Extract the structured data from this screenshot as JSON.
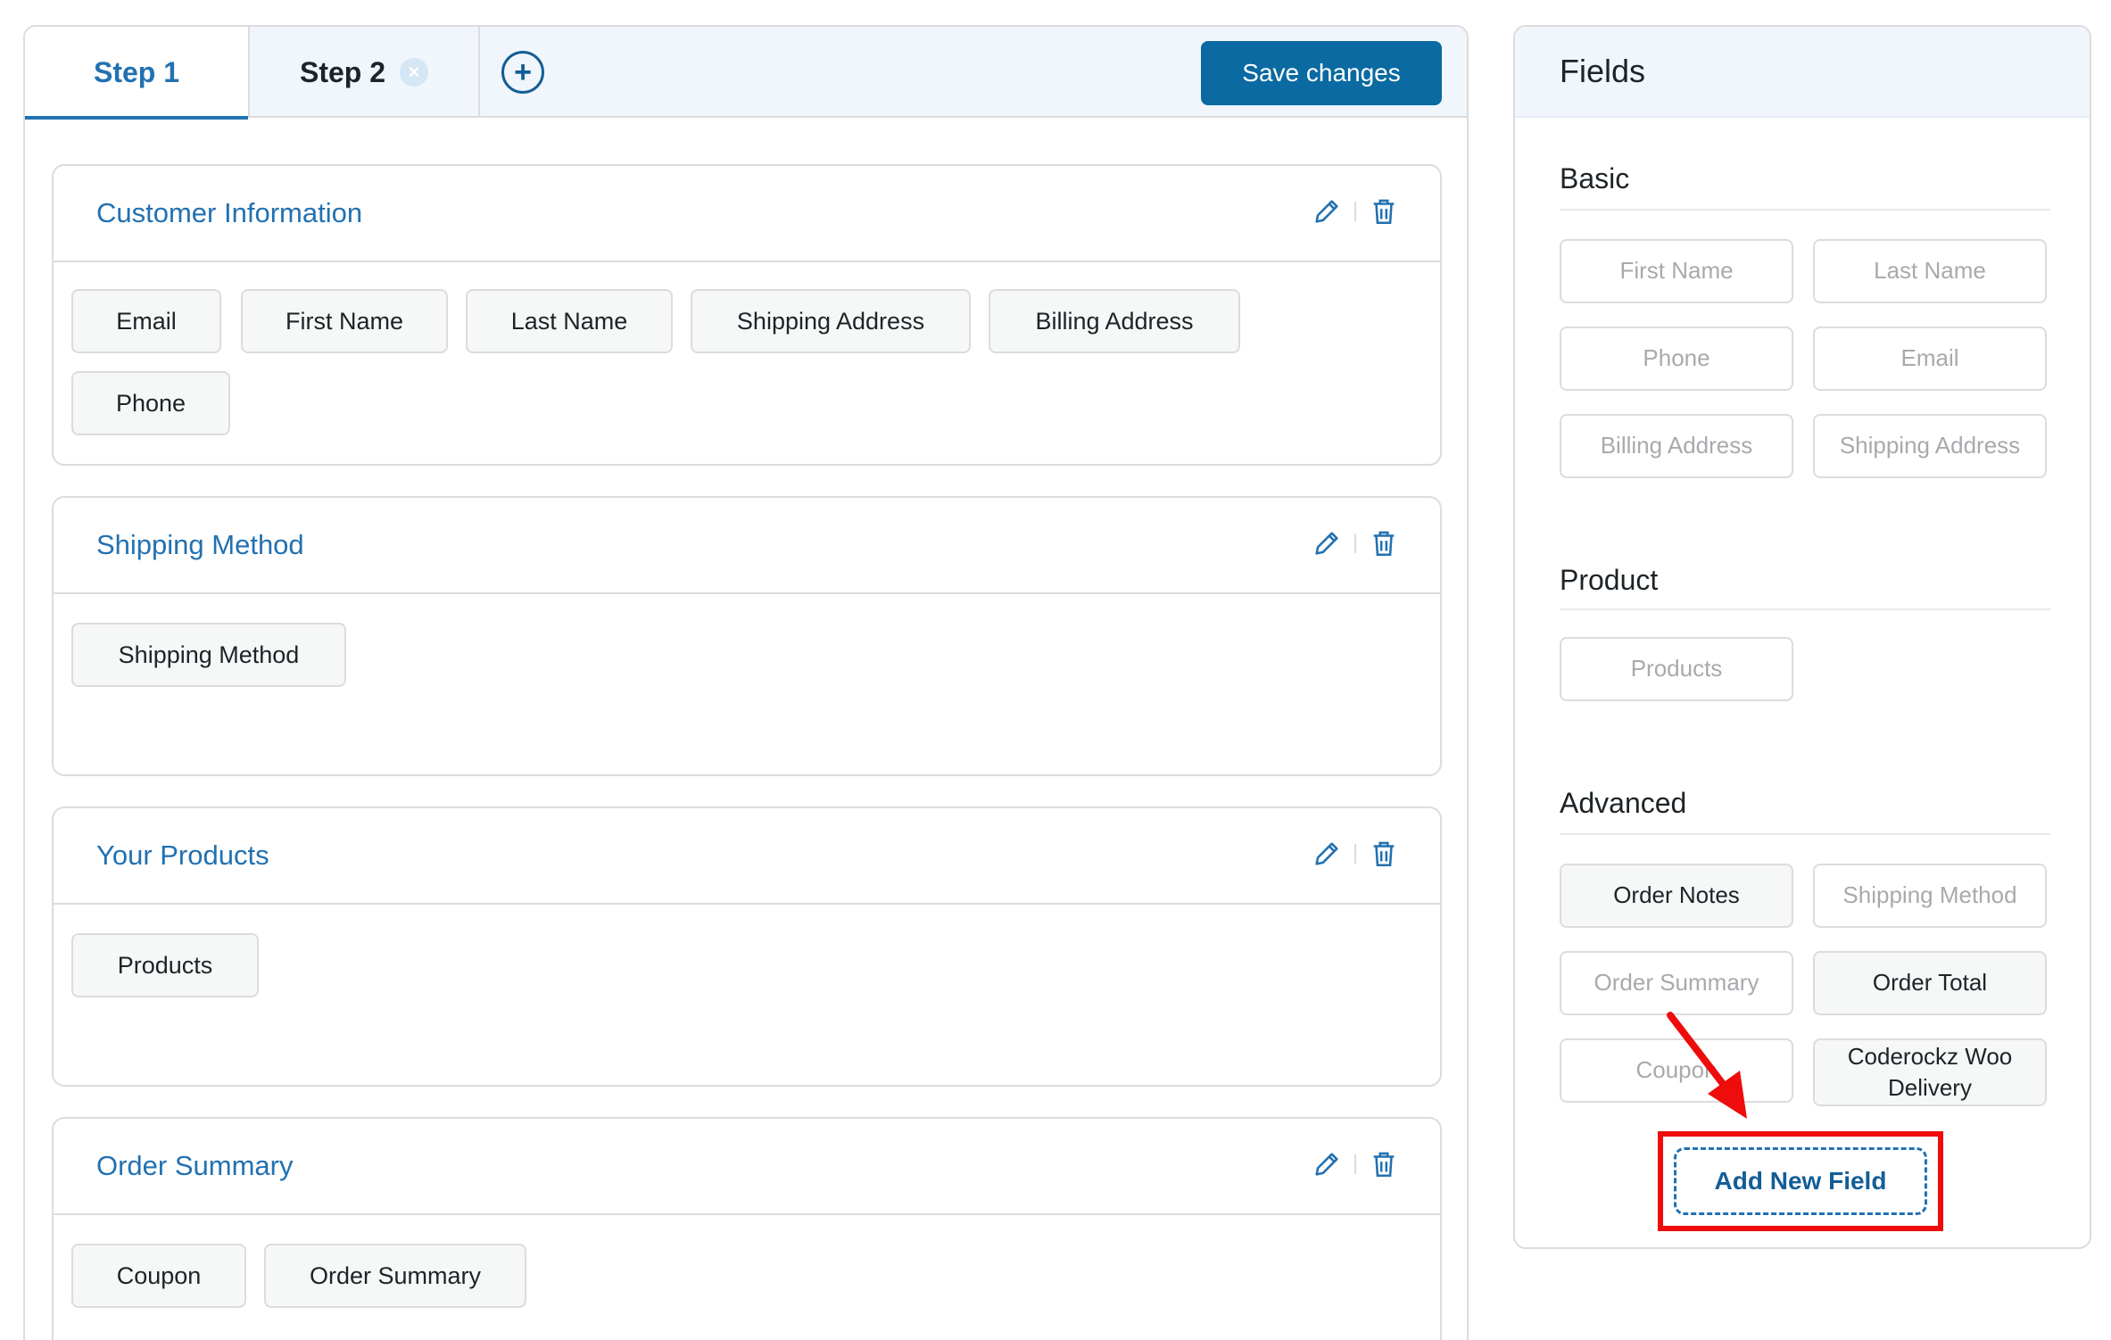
{
  "tabs": {
    "step1": "Step 1",
    "step2": "Step 2",
    "close_glyph": "×",
    "add_glyph": "+"
  },
  "toolbar": {
    "save_label": "Save changes"
  },
  "sections": [
    {
      "title": "Customer Information",
      "fields": [
        "Email",
        "First Name",
        "Last Name",
        "Shipping Address",
        "Billing Address",
        "Phone"
      ]
    },
    {
      "title": "Shipping Method",
      "fields": [
        "Shipping Method"
      ]
    },
    {
      "title": "Your Products",
      "fields": [
        "Products"
      ]
    },
    {
      "title": "Order Summary",
      "fields": [
        "Coupon",
        "Order Summary"
      ]
    }
  ],
  "fields_panel": {
    "title": "Fields",
    "groups": [
      {
        "title": "Basic",
        "items": [
          {
            "label": "First Name",
            "active": false
          },
          {
            "label": "Last Name",
            "active": false
          },
          {
            "label": "Phone",
            "active": false
          },
          {
            "label": "Email",
            "active": false
          },
          {
            "label": "Billing Address",
            "active": false
          },
          {
            "label": "Shipping Address",
            "active": false
          }
        ]
      },
      {
        "title": "Product",
        "items": [
          {
            "label": "Products",
            "active": false
          }
        ]
      },
      {
        "title": "Advanced",
        "items": [
          {
            "label": "Order Notes",
            "active": true
          },
          {
            "label": "Shipping Method",
            "active": false
          },
          {
            "label": "Order Summary",
            "active": false
          },
          {
            "label": "Order Total",
            "active": true
          },
          {
            "label": "Coupon",
            "active": false
          },
          {
            "label": "Coderockz Woo Delivery",
            "active": true
          }
        ]
      }
    ],
    "add_new_label": "Add New Field"
  },
  "colors": {
    "accent": "#2271b1",
    "primary_button": "#0a6aa1",
    "highlight": "#ee0c0c"
  }
}
